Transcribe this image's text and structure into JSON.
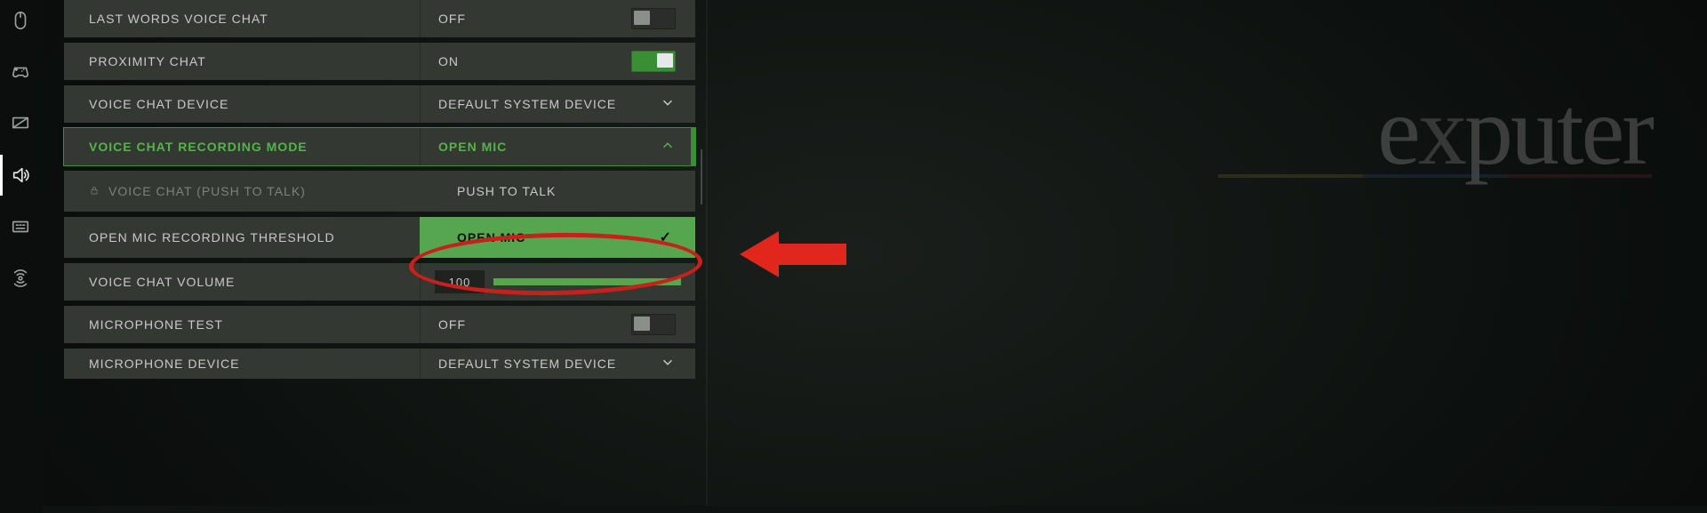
{
  "sidebar": {
    "items": [
      {
        "name": "mouse"
      },
      {
        "name": "controller"
      },
      {
        "name": "display"
      },
      {
        "name": "audio",
        "active": true
      },
      {
        "name": "keyboard"
      },
      {
        "name": "network"
      }
    ]
  },
  "settings": {
    "last_words": {
      "label": "LAST WORDS VOICE CHAT",
      "value": "OFF",
      "toggle": "off"
    },
    "proximity": {
      "label": "PROXIMITY CHAT",
      "value": "ON",
      "toggle": "on"
    },
    "voice_device": {
      "label": "VOICE CHAT DEVICE",
      "value": "DEFAULT SYSTEM DEVICE"
    },
    "recording_mode": {
      "label": "VOICE CHAT RECORDING MODE",
      "value": "OPEN MIC",
      "options": [
        "PUSH TO TALK",
        "OPEN MIC"
      ],
      "selected": "OPEN MIC"
    },
    "push_to_talk": {
      "label": "VOICE CHAT (PUSH TO TALK)"
    },
    "open_mic_thresh": {
      "label": "OPEN MIC RECORDING THRESHOLD"
    },
    "voice_volume": {
      "label": "VOICE CHAT VOLUME",
      "value": "100"
    },
    "mic_test": {
      "label": "MICROPHONE TEST",
      "value": "OFF",
      "toggle": "off"
    },
    "mic_device": {
      "label": "MICROPHONE DEVICE",
      "value": "DEFAULT SYSTEM DEVICE"
    }
  },
  "watermark": {
    "text": "exputer"
  },
  "colors": {
    "accent": "#52b449",
    "row_bg": "#343833",
    "danger": "#e1261c"
  }
}
